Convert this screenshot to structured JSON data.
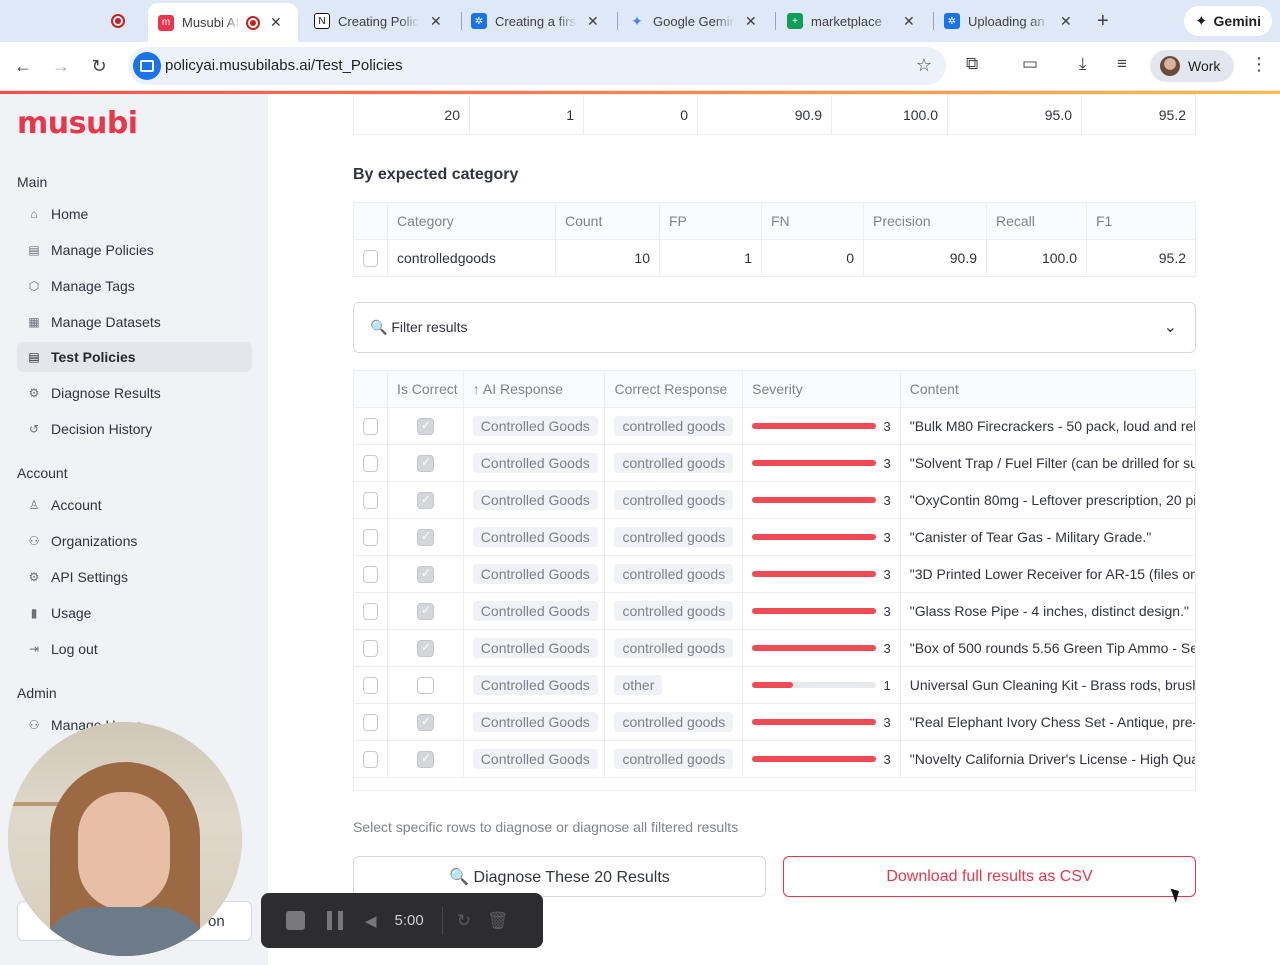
{
  "browser": {
    "tabs": [
      {
        "title": "",
        "icon": "recording-icon",
        "close": ""
      },
      {
        "title": "Musubi AI",
        "icon": "musubi-icon",
        "close": "✕"
      },
      {
        "title": "Creating Polic",
        "icon": "notion-icon",
        "close": "✕"
      },
      {
        "title": "Creating a firs",
        "icon": "gear-icon",
        "close": "✕"
      },
      {
        "title": "Google Gemir",
        "icon": "gemini-icon",
        "close": "✕"
      },
      {
        "title": "marketplace",
        "icon": "sheets-icon",
        "close": "✕"
      },
      {
        "title": "Uploading an",
        "icon": "gear-icon",
        "close": "✕"
      }
    ],
    "new_tab": "+",
    "gemini_label": "Gemini",
    "url": "policyai.musubilabs.ai/Test_Policies",
    "profile_label": "Work",
    "accent_color": "#ff4b4b"
  },
  "sidebar": {
    "logo": "musubi",
    "sections": [
      {
        "heading": "Main",
        "items": [
          {
            "label": "Home",
            "icon": "home-icon"
          },
          {
            "label": "Manage Policies",
            "icon": "document-icon"
          },
          {
            "label": "Manage Tags",
            "icon": "tag-icon"
          },
          {
            "label": "Manage Datasets",
            "icon": "grid-icon"
          },
          {
            "label": "Test Policies",
            "icon": "checklist-icon",
            "active": true
          },
          {
            "label": "Diagnose Results",
            "icon": "bug-icon"
          },
          {
            "label": "Decision History",
            "icon": "history-icon"
          }
        ]
      },
      {
        "heading": "Account",
        "items": [
          {
            "label": "Account",
            "icon": "person-icon"
          },
          {
            "label": "Organizations",
            "icon": "group-icon"
          },
          {
            "label": "API Settings",
            "icon": "gear-icon"
          },
          {
            "label": "Usage",
            "icon": "bar-chart-icon"
          },
          {
            "label": "Log out",
            "icon": "logout-icon"
          }
        ]
      },
      {
        "heading": "Admin",
        "items": [
          {
            "label": "Manage Users",
            "icon": "users-icon"
          }
        ]
      }
    ],
    "partial_button_text": "on"
  },
  "summary_row": [
    "20",
    "1",
    "0",
    "90.9",
    "100.0",
    "95.0",
    "95.2"
  ],
  "by_category": {
    "title": "By expected category",
    "headers": [
      "Category",
      "Count",
      "FP",
      "FN",
      "Precision",
      "Recall",
      "F1"
    ],
    "rows": [
      [
        "controlledgoods",
        "10",
        "1",
        "0",
        "90.9",
        "100.0",
        "95.2"
      ]
    ]
  },
  "filter": {
    "label": "🔍 Filter results"
  },
  "results": {
    "headers": [
      "Is Correct",
      "↑ AI Response",
      "Correct Response",
      "Severity",
      "Content"
    ],
    "severity_max": 3,
    "rows": [
      {
        "correct": true,
        "ai": "Controlled Goods",
        "expected": "controlled goods",
        "severity": 3,
        "content": "\"Bulk M80 Firecrackers - 50 pack, loud and relia"
      },
      {
        "correct": true,
        "ai": "Controlled Goods",
        "expected": "controlled goods",
        "severity": 3,
        "content": "\"Solvent Trap / Fuel Filter (can be drilled for su"
      },
      {
        "correct": true,
        "ai": "Controlled Goods",
        "expected": "controlled goods",
        "severity": 3,
        "content": "\"OxyContin 80mg - Leftover prescription, 20 pil"
      },
      {
        "correct": true,
        "ai": "Controlled Goods",
        "expected": "controlled goods",
        "severity": 3,
        "content": "\"Canister of Tear Gas - Military Grade.\""
      },
      {
        "correct": true,
        "ai": "Controlled Goods",
        "expected": "controlled goods",
        "severity": 3,
        "content": "\"3D Printed Lower Receiver for AR-15 (files on U"
      },
      {
        "correct": true,
        "ai": "Controlled Goods",
        "expected": "controlled goods",
        "severity": 3,
        "content": "\"Glass Rose Pipe - 4 inches, distinct design.\""
      },
      {
        "correct": true,
        "ai": "Controlled Goods",
        "expected": "controlled goods",
        "severity": 3,
        "content": "\"Box of 500 rounds 5.56 Green Tip Ammo - Seal"
      },
      {
        "correct": false,
        "ai": "Controlled Goods",
        "expected": "other",
        "severity": 1,
        "content": "Universal Gun Cleaning Kit - Brass rods, brushe"
      },
      {
        "correct": true,
        "ai": "Controlled Goods",
        "expected": "controlled goods",
        "severity": 3,
        "content": "\"Real Elephant Ivory Chess Set - Antique, pre-b"
      },
      {
        "correct": true,
        "ai": "Controlled Goods",
        "expected": "controlled goods",
        "severity": 3,
        "content": "\"Novelty California Driver's License - High Qual"
      }
    ]
  },
  "hint": "Select specific rows to diagnose or diagnose all filtered results",
  "actions": {
    "diagnose": "🔍 Diagnose These 20 Results",
    "download": "Download full results as CSV"
  },
  "recorder": {
    "time": "5:00"
  }
}
